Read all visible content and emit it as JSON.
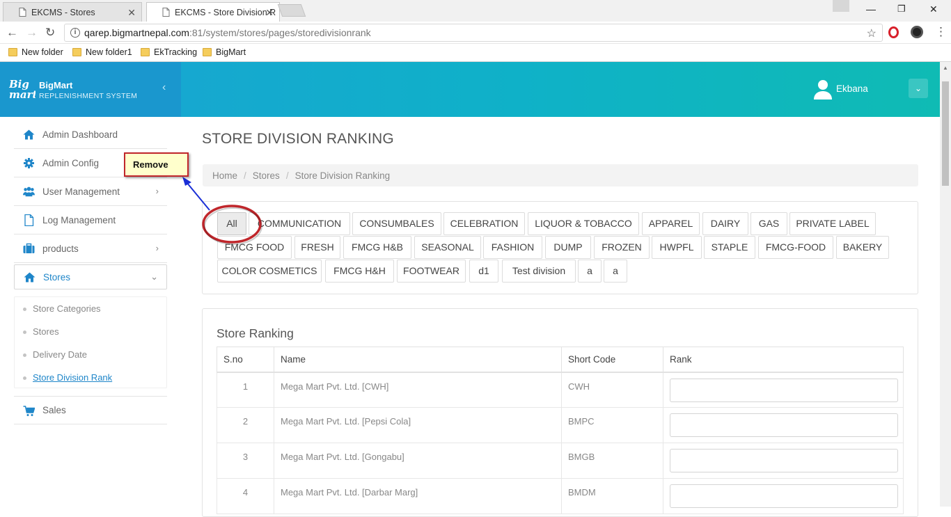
{
  "browser": {
    "tabs": [
      {
        "title": "EKCMS - Stores"
      },
      {
        "title": "EKCMS - Store Division R"
      }
    ],
    "url_host": "qarep.bigmartnepal.com",
    "url_path": ":81/system/stores/pages/storedivisionrank",
    "bookmarks": [
      "New folder",
      "New folder1",
      "EkTracking",
      "BigMart"
    ]
  },
  "header": {
    "logo_text": "Big mart",
    "brand_title": "BigMart",
    "brand_subtitle": "REPLENISHMENT SYSTEM",
    "username": "Ekbana"
  },
  "sidebar": {
    "items": [
      {
        "label": "Admin Dashboard",
        "icon": "home-icon"
      },
      {
        "label": "Admin Config",
        "icon": "gear-icon"
      },
      {
        "label": "User Management",
        "icon": "users-icon"
      },
      {
        "label": "Log Management",
        "icon": "file-icon"
      },
      {
        "label": "products",
        "icon": "briefcase-icon"
      },
      {
        "label": "Stores",
        "icon": "home-icon"
      },
      {
        "label": "Sales",
        "icon": "cart-icon"
      }
    ],
    "store_submenu": [
      "Store Categories",
      "Stores",
      "Delivery Date",
      "Store Division Rank"
    ]
  },
  "page": {
    "title": "STORE DIVISION RANKING",
    "breadcrumb": [
      "Home",
      "Stores",
      "Store Division Ranking"
    ]
  },
  "divisions": [
    "All",
    "COMMUNICATION",
    "CONSUMBALES",
    "CELEBRATION",
    "LIQUOR & TOBACCO",
    "APPAREL",
    "DAIRY",
    "GAS",
    "PRIVATE LABEL",
    "FMCG FOOD",
    "FRESH",
    "FMCG H&B",
    "SEASONAL",
    "FASHION",
    "DUMP",
    "FROZEN",
    "HWPFL",
    "STAPLE",
    "FMCG-FOOD",
    "BAKERY",
    "COLOR COSMETICS",
    "FMCG H&H",
    "FOOTWEAR",
    "d1",
    "Test division",
    "a",
    "a"
  ],
  "selected_division": "All",
  "ranking": {
    "title": "Store Ranking",
    "columns": [
      "S.no",
      "Name",
      "Short Code",
      "Rank"
    ],
    "rows": [
      {
        "sno": "1",
        "name": "Mega Mart Pvt. Ltd. [CWH]",
        "code": "CWH",
        "rank": ""
      },
      {
        "sno": "2",
        "name": "Mega Mart Pvt. Ltd. [Pepsi Cola]",
        "code": "BMPC",
        "rank": ""
      },
      {
        "sno": "3",
        "name": "Mega Mart Pvt. Ltd. [Gongabu]",
        "code": "BMGB",
        "rank": ""
      },
      {
        "sno": "4",
        "name": "Mega Mart Pvt. Ltd. [Darbar Marg]",
        "code": "BMDM",
        "rank": ""
      }
    ]
  },
  "annotation": {
    "callout_text": "Remove"
  },
  "colors": {
    "header_start": "#1aa3d4",
    "header_end": "#0fbbb4",
    "accent_link": "#1f86c9",
    "annotation_red": "#c0262b",
    "arrow_blue": "#1a2fd6"
  }
}
